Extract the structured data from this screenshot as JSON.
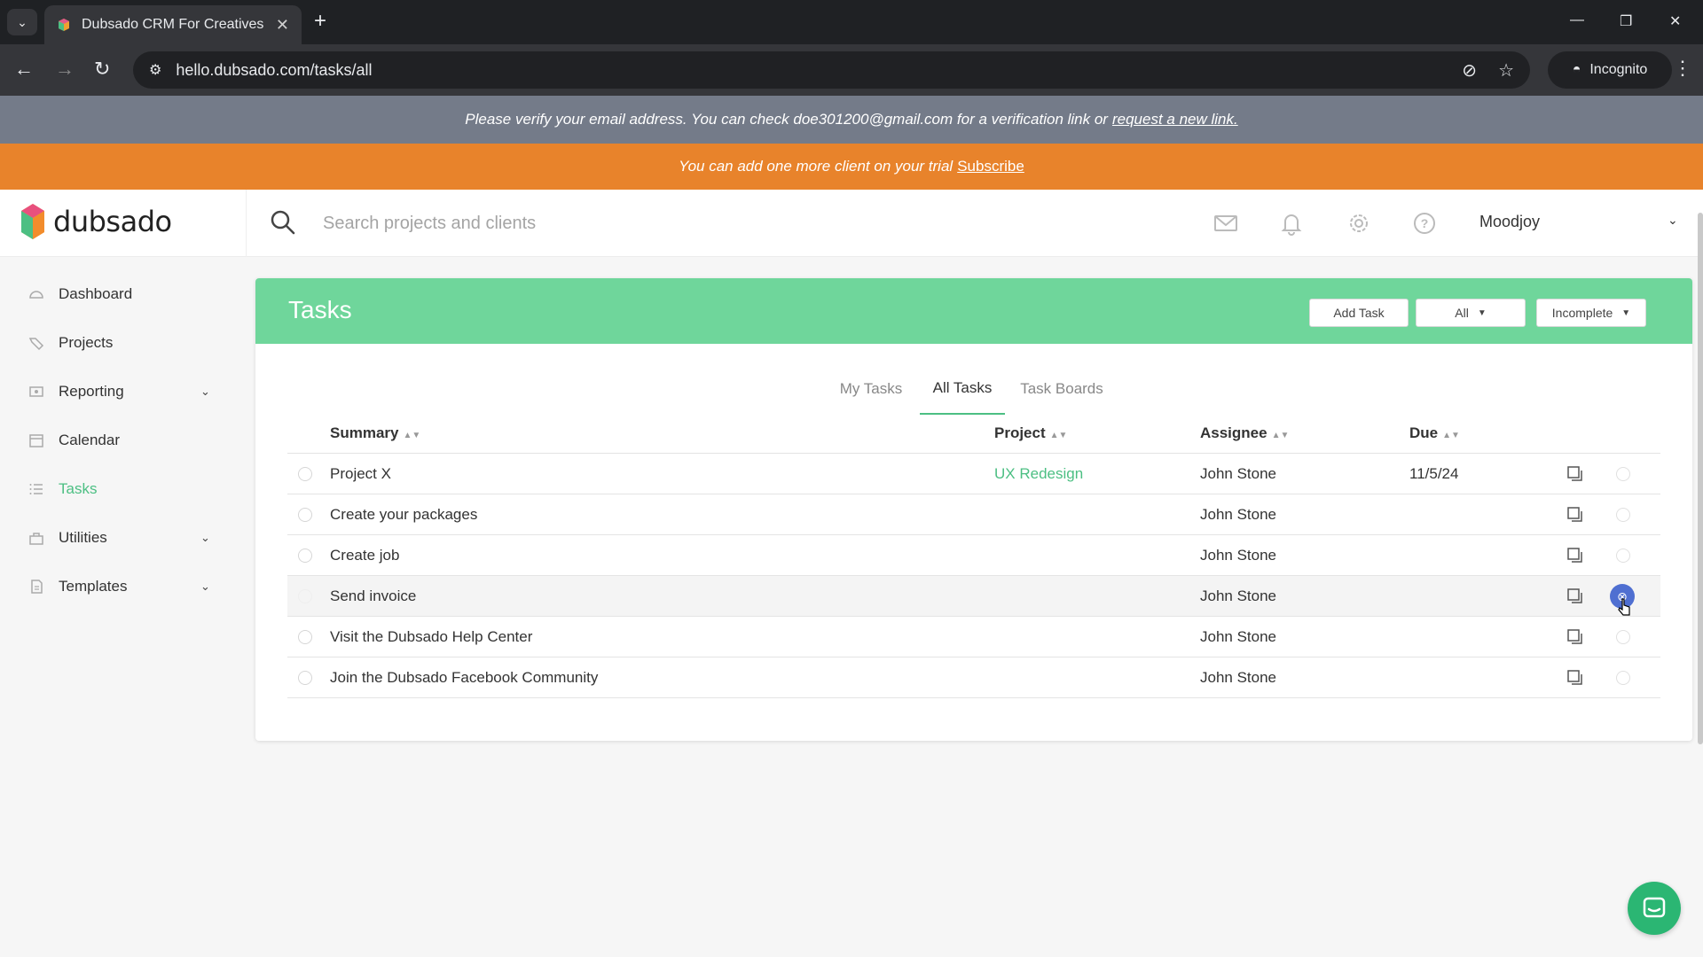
{
  "browser": {
    "tab_title": "Dubsado CRM For Creatives",
    "url": "hello.dubsado.com/tasks/all",
    "incognito_label": "Incognito",
    "icons": [
      "tab-list-icon",
      "close-tab-icon",
      "new-tab-icon",
      "minimize-icon",
      "restore-icon",
      "close-window-icon",
      "back-icon",
      "forward-icon",
      "reload-icon",
      "site-info-icon",
      "eye-off-icon",
      "star-icon",
      "incognito-icon",
      "menu-icon"
    ]
  },
  "banners": {
    "verify_text": "Please verify your email address. You can check doe301200@gmail.com for a verification link or",
    "verify_link": "request a new link.",
    "trial_text": "You can add one more client on your trial",
    "trial_link": "Subscribe"
  },
  "header": {
    "logo_text": "dubsado",
    "search_placeholder": "Search projects and clients",
    "user_name": "Moodjoy",
    "icons": [
      "mail-icon",
      "bell-icon",
      "gear-icon",
      "help-icon"
    ]
  },
  "sidebar": {
    "items": [
      {
        "label": "Dashboard",
        "icon": "dashboard-icon"
      },
      {
        "label": "Projects",
        "icon": "projects-icon"
      },
      {
        "label": "Reporting",
        "icon": "reporting-icon",
        "expandable": true
      },
      {
        "label": "Calendar",
        "icon": "calendar-icon"
      },
      {
        "label": "Tasks",
        "icon": "tasks-icon",
        "active": true
      },
      {
        "label": "Utilities",
        "icon": "utilities-icon",
        "expandable": true
      },
      {
        "label": "Templates",
        "icon": "templates-icon",
        "expandable": true
      }
    ]
  },
  "tasks": {
    "title": "Tasks",
    "add_task_label": "Add Task",
    "filter_all_label": "All",
    "filter_status_label": "Incomplete",
    "tabs": [
      {
        "label": "My Tasks",
        "active": false
      },
      {
        "label": "All Tasks",
        "active": true
      },
      {
        "label": "Task Boards",
        "active": false
      }
    ],
    "columns": {
      "summary": "Summary",
      "project": "Project",
      "assignee": "Assignee",
      "due": "Due"
    },
    "rows": [
      {
        "summary": "Project X",
        "project": "UX Redesign",
        "assignee": "John Stone",
        "due": "11/5/24"
      },
      {
        "summary": "Create your packages",
        "project": "",
        "assignee": "John Stone",
        "due": ""
      },
      {
        "summary": "Create job",
        "project": "",
        "assignee": "John Stone",
        "due": ""
      },
      {
        "summary": "Send invoice",
        "project": "",
        "assignee": "John Stone",
        "due": "",
        "hovered": true
      },
      {
        "summary": "Visit the Dubsado Help Center",
        "project": "",
        "assignee": "John Stone",
        "due": ""
      },
      {
        "summary": "Join the Dubsado Facebook Community",
        "project": "",
        "assignee": "John Stone",
        "due": ""
      }
    ]
  },
  "colors": {
    "accent_green": "#4cbf83",
    "panel_header": "#6fd69b",
    "verify_banner": "#747b89",
    "trial_banner": "#e8832b",
    "delete_hover": "#4f6fd1"
  }
}
